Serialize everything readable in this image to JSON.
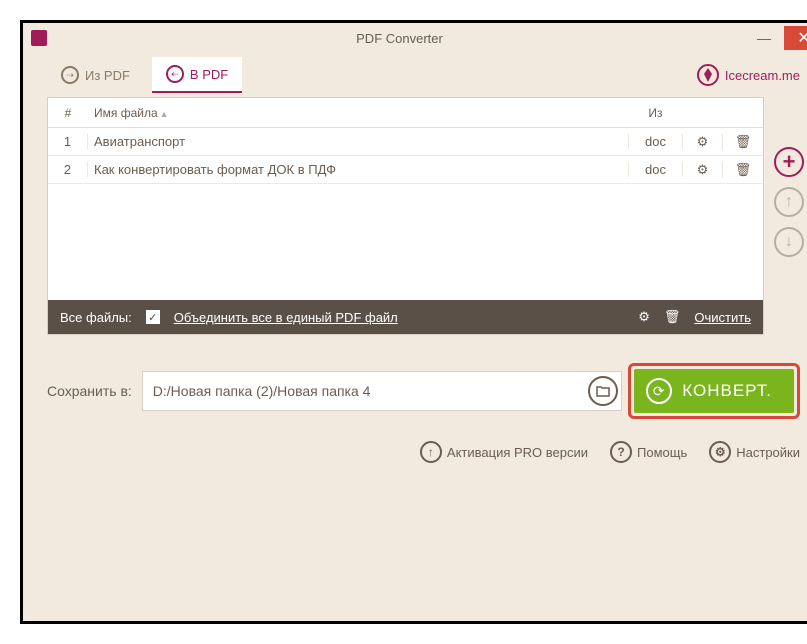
{
  "window": {
    "title": "PDF Converter"
  },
  "tabs": {
    "fromPdf": "Из PDF",
    "toPdf": "В PDF"
  },
  "icecream": "Icecream.me",
  "table": {
    "colNum": "#",
    "colName": "Имя файла",
    "colFrom": "Из",
    "rows": [
      {
        "num": "1",
        "name": "Авиатранспорт",
        "from": "doc"
      },
      {
        "num": "2",
        "name": "Как конвертировать формат ДОК в ПДФ",
        "from": "doc"
      }
    ]
  },
  "footer": {
    "allFiles": "Все файлы:",
    "merge": "Объединить все в единый PDF файл",
    "clear": "Очистить"
  },
  "save": {
    "label": "Сохранить в:",
    "path": "D:/Новая папка (2)/Новая папка 4"
  },
  "convert": "КОНВЕРТ.",
  "bottom": {
    "pro": "Активация PRO версии",
    "help": "Помощь",
    "settings": "Настройки"
  }
}
